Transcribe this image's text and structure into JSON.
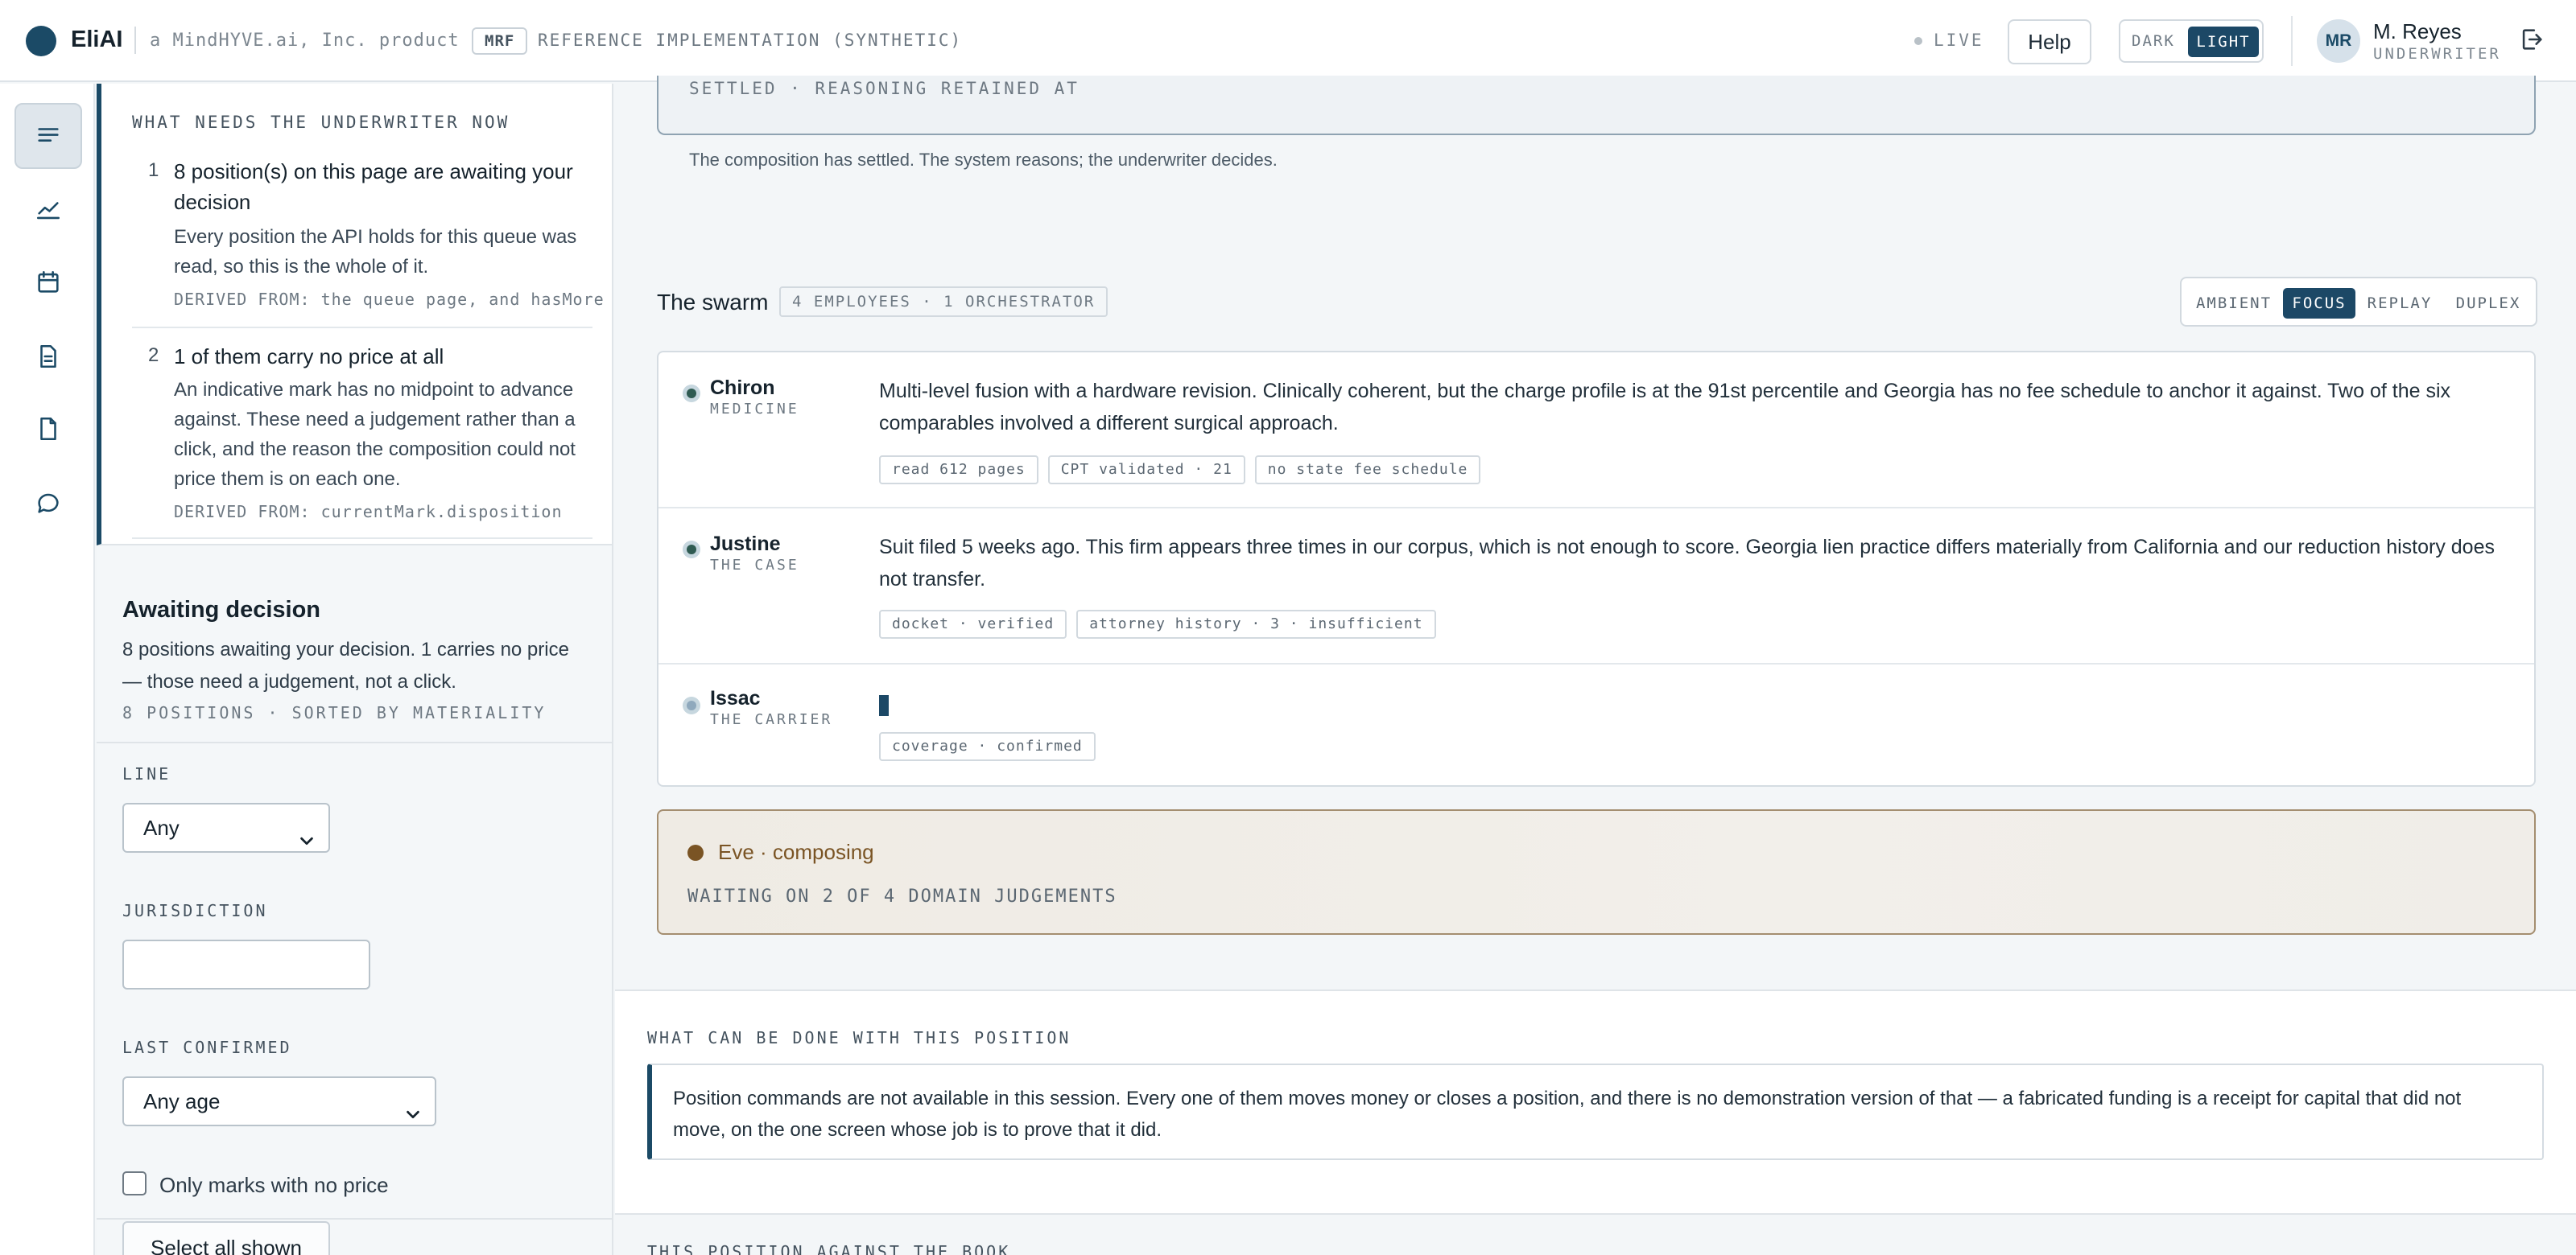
{
  "header": {
    "brand": "EliAI",
    "tagline": "a MindHYVE.ai, Inc. product",
    "badge": "MRF",
    "subtitle": "REFERENCE IMPLEMENTATION (SYNTHETIC)",
    "live": "LIVE",
    "help": "Help",
    "theme_dark": "DARK",
    "theme_light": "LIGHT",
    "user_initials": "MR",
    "user_name": "M. Reyes",
    "user_role": "UNDERWRITER"
  },
  "rail": [
    "list-icon",
    "trend-icon",
    "calendar-icon",
    "document-icon",
    "file-icon",
    "chat-icon"
  ],
  "needs": {
    "title": "WHAT NEEDS THE UNDERWRITER NOW",
    "items": [
      {
        "num": "1",
        "head": "8 position(s) on this page are awaiting your decision",
        "body": "Every position the API holds for this queue was read, so this is the whole of it.",
        "source": "DERIVED FROM: the queue page, and hasMore"
      },
      {
        "num": "2",
        "head": "1 of them carry no price at all",
        "body": "An indicative mark has no midpoint to advance against. These need a judgement rather than a click, and the reason the composition could not price them is on each one.",
        "source": "DERIVED FROM: currentMark.disposition"
      }
    ]
  },
  "awaiting": {
    "title": "Awaiting decision",
    "desc": "8 positions awaiting your decision. 1 carries no price — those need a judgement, not a click.",
    "meta": "8 POSITIONS · SORTED BY MATERIALITY"
  },
  "filters": {
    "line_label": "LINE",
    "line_value": "Any",
    "jurisdiction_label": "JURISDICTION",
    "jurisdiction_value": "",
    "confirmed_label": "LAST CONFIRMED",
    "confirmed_value": "Any age",
    "no_price_label": "Only marks with no price",
    "select_all": "Select all shown"
  },
  "settled": {
    "label": "SETTLED · REASONING RETAINED AT",
    "note": "The composition has settled. The system reasons; the underwriter decides."
  },
  "swarm": {
    "title": "The swarm",
    "badge": "4 EMPLOYEES · 1 ORCHESTRATOR",
    "modes": [
      "AMBIENT",
      "FOCUS",
      "REPLAY",
      "DUPLEX"
    ],
    "active_mode": "FOCUS",
    "agents": [
      {
        "name": "Chiron",
        "role": "MEDICINE",
        "text": "Multi-level fusion with a hardware revision. Clinically coherent, but the charge profile is at the 91st percentile and Georgia has no fee schedule to anchor it against. Two of the six comparables involved a different surgical approach.",
        "tags": [
          "read 612 pages",
          "CPT validated · 21",
          "no state fee schedule"
        ]
      },
      {
        "name": "Justine",
        "role": "THE CASE",
        "text": "Suit filed 5 weeks ago. This firm appears three times in our corpus, which is not enough to score. Georgia lien practice differs materially from California and our reduction history does not transfer.",
        "tags": [
          "docket · verified",
          "attorney history · 3 · insufficient"
        ]
      },
      {
        "name": "Issac",
        "role": "THE CARRIER",
        "text": "",
        "tags": [
          "coverage · confirmed"
        ]
      }
    ],
    "eve_title": "Eve · composing",
    "eve_status": "WAITING ON 2 OF 4 DOMAIN JUDGEMENTS"
  },
  "actions": {
    "title": "WHAT CAN BE DONE WITH THIS POSITION",
    "notice": "Position commands are not available in this session. Every one of them moves money or closes a position, and there is no demonstration version of that — a fabricated funding is a receipt for capital that did not move, on the one screen whose job is to prove that it did."
  },
  "book_title": "THIS POSITION AGAINST THE BOOK"
}
